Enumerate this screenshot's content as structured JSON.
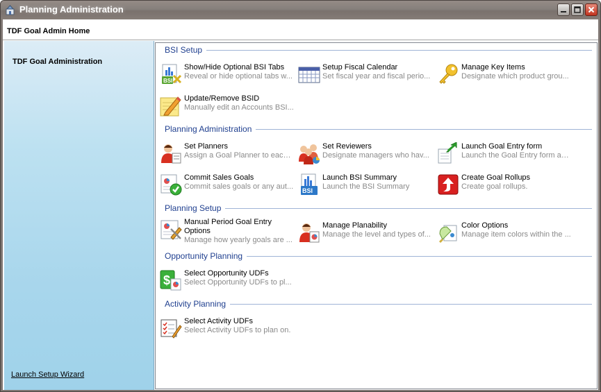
{
  "window": {
    "title": "Planning Administration"
  },
  "header": {
    "title": "TDF Goal Admin Home"
  },
  "sidebar": {
    "title": "TDF Goal Administration",
    "wizard_link": "Launch Setup Wizard"
  },
  "sections": {
    "bsi_setup": {
      "title": "BSI Setup",
      "items": [
        {
          "label": "Show/Hide Optional BSI Tabs",
          "desc": "Reveal or hide optional tabs w...",
          "icon": "bsi-tabs-icon"
        },
        {
          "label": "Setup Fiscal Calendar",
          "desc": "Set fiscal year and fiscal perio...",
          "icon": "calendar-icon"
        },
        {
          "label": "Manage Key Items",
          "desc": "Designate which product grou...",
          "icon": "key-icon"
        },
        {
          "label": "Update/Remove BSID",
          "desc": "Manually edit an Accounts BSI...",
          "icon": "pencil-icon"
        }
      ]
    },
    "planning_admin": {
      "title": "Planning Administration",
      "items": [
        {
          "label": "Set Planners",
          "desc": "Assign a Goal Planner to each ...",
          "icon": "planner-icon"
        },
        {
          "label": "Set Reviewers",
          "desc": "Designate managers who hav...",
          "icon": "reviewers-icon"
        },
        {
          "label": "Launch Goal Entry form",
          "desc": "Launch the Goal Entry form an...",
          "icon": "goal-entry-icon"
        },
        {
          "label": "Commit Sales Goals",
          "desc": "Commit sales goals or any aut...",
          "icon": "commit-icon"
        },
        {
          "label": "Launch BSI Summary",
          "desc": "Launch the BSI Summary",
          "icon": "bsi-summary-icon"
        },
        {
          "label": "Create Goal Rollups",
          "desc": "Create goal rollups.",
          "icon": "rollup-icon"
        }
      ]
    },
    "planning_setup": {
      "title": "Planning Setup",
      "items": [
        {
          "label": "Manual Period Goal Entry Options",
          "desc": "Manage how yearly goals are ...",
          "icon": "period-entry-icon"
        },
        {
          "label": "Manage Planability",
          "desc": "Manage the level and types of...",
          "icon": "planability-icon"
        },
        {
          "label": "Color Options",
          "desc": "Manage item colors within the ...",
          "icon": "color-icon"
        }
      ]
    },
    "opportunity_planning": {
      "title": "Opportunity Planning",
      "items": [
        {
          "label": "Select Opportunity UDFs",
          "desc": "Select Opportunity UDFs to pl...",
          "icon": "opportunity-icon"
        }
      ]
    },
    "activity_planning": {
      "title": "Activity Planning",
      "items": [
        {
          "label": "Select Activity UDFs",
          "desc": "Select Activity UDFs to plan on.",
          "icon": "activity-icon"
        }
      ]
    }
  }
}
